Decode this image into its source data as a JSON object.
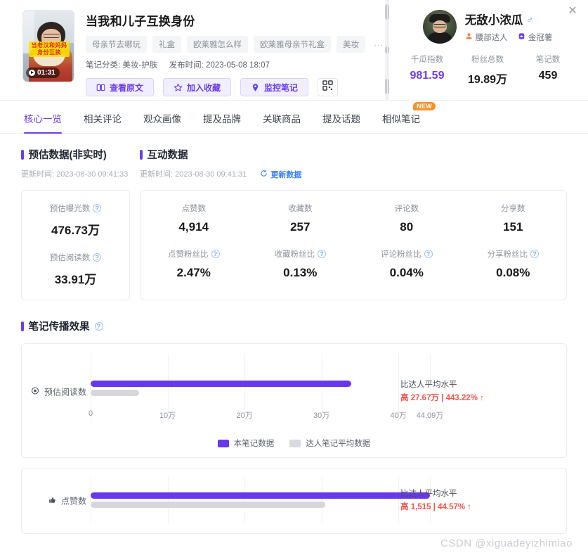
{
  "note": {
    "title": "当我和儿子互换身份",
    "duration": "01:31",
    "thumb_overlay": "当老汉和妈妈\n身份互换",
    "tags": [
      "母亲节去哪玩",
      "礼盒",
      "欧莱雅怎么样",
      "欧莱雅母亲节礼盒",
      "美妆"
    ],
    "tag_more": "···",
    "category_label": "笔记分类:",
    "category_value": "美妆-护肤",
    "publish_label": "发布时间:",
    "publish_value": "2023-05-08 18:07",
    "buttons": [
      {
        "label": "查看原文",
        "icon": "book-icon"
      },
      {
        "label": "加入收藏",
        "icon": "star-icon"
      },
      {
        "label": "监控笔记",
        "icon": "location-pin-icon"
      }
    ],
    "qr_icon": "qrcode-icon"
  },
  "author": {
    "name": "无敌小浓瓜",
    "gender_icon": "male-icon",
    "badges": [
      {
        "label": "腰部达人",
        "icon": "person-icon"
      },
      {
        "label": "金冠薯",
        "icon": "crown-icon"
      }
    ],
    "stats": [
      {
        "label": "千瓜指数",
        "value": "981.59",
        "accent": true
      },
      {
        "label": "粉丝总数",
        "value": "19.89万",
        "accent": false
      },
      {
        "label": "笔记数",
        "value": "459",
        "accent": false
      }
    ],
    "close_icon": "close-icon"
  },
  "tabs": [
    {
      "label": "核心一览",
      "active": true
    },
    {
      "label": "相关评论",
      "active": false
    },
    {
      "label": "观众画像",
      "active": false
    },
    {
      "label": "提及品牌",
      "active": false
    },
    {
      "label": "关联商品",
      "active": false
    },
    {
      "label": "提及话题",
      "active": false
    },
    {
      "label": "相似笔记",
      "active": false,
      "badge": "NEW"
    }
  ],
  "estimate": {
    "title": "预估数据(非实时)",
    "updated": "更新时间: 2023-08-30 09:41:33",
    "metrics": [
      {
        "label": "预估曝光数",
        "value": "476.73万",
        "help": true
      },
      {
        "label": "预估阅读数",
        "value": "33.91万",
        "help": true
      }
    ]
  },
  "interaction": {
    "title": "互动数据",
    "updated": "更新时间: 2023-08-30 09:41:31",
    "refresh_label": "更新数据",
    "refresh_icon": "refresh-icon",
    "row1": [
      {
        "label": "点赞数",
        "value": "4,914",
        "help": false
      },
      {
        "label": "收藏数",
        "value": "257",
        "help": false
      },
      {
        "label": "评论数",
        "value": "80",
        "help": false
      },
      {
        "label": "分享数",
        "value": "151",
        "help": false
      }
    ],
    "row2": [
      {
        "label": "点赞粉丝比",
        "value": "2.47%",
        "help": true
      },
      {
        "label": "收藏粉丝比",
        "value": "0.13%",
        "help": true
      },
      {
        "label": "评论粉丝比",
        "value": "0.04%",
        "help": true
      },
      {
        "label": "分享粉丝比",
        "value": "0.08%",
        "help": true
      }
    ]
  },
  "spread": {
    "title": "笔记传播效果",
    "help": true,
    "legend": [
      {
        "label": "本笔记数据",
        "color": "#6638f0"
      },
      {
        "label": "达人笔记平均数据",
        "color": "#d9dadd"
      }
    ]
  },
  "chart_data": [
    {
      "type": "bar",
      "orientation": "horizontal",
      "title": "",
      "category_label": "预估阅读数",
      "category_icon": "eye-icon",
      "series": [
        {
          "name": "本笔记数据",
          "value": 339100,
          "color": "#6638f0"
        },
        {
          "name": "达人笔记平均数据",
          "value": 62400,
          "color": "#d6d7da"
        }
      ],
      "xlim": [
        0,
        440900
      ],
      "xticks": [
        0,
        100000,
        200000,
        300000,
        400000,
        440900
      ],
      "xticklabels": [
        "0",
        "10万",
        "20万",
        "30万",
        "40万",
        "44.09万"
      ],
      "annotation_title": "比达人平均水平",
      "annotation_value": "高 27.67万 | 443.22% ↑",
      "annotation_color": "#f5554a",
      "grid": true,
      "legend_position": "bottom"
    },
    {
      "type": "bar",
      "orientation": "horizontal",
      "title": "",
      "category_label": "点赞数",
      "category_icon": "thumbs-up-icon",
      "series": [
        {
          "name": "本笔记数据",
          "value": 4914,
          "color": "#6638f0"
        },
        {
          "name": "达人笔记平均数据",
          "value": 3399,
          "color": "#d6d7da"
        }
      ],
      "xlim": [
        0,
        5500
      ],
      "xticks": [],
      "xticklabels": [],
      "annotation_title": "比达人平均水平",
      "annotation_value": "高 1,515 | 44.57% ↑",
      "annotation_color": "#f5554a",
      "grid": true,
      "legend_position": "none"
    }
  ],
  "watermark": "CSDN @xiguadeyizhimiao"
}
